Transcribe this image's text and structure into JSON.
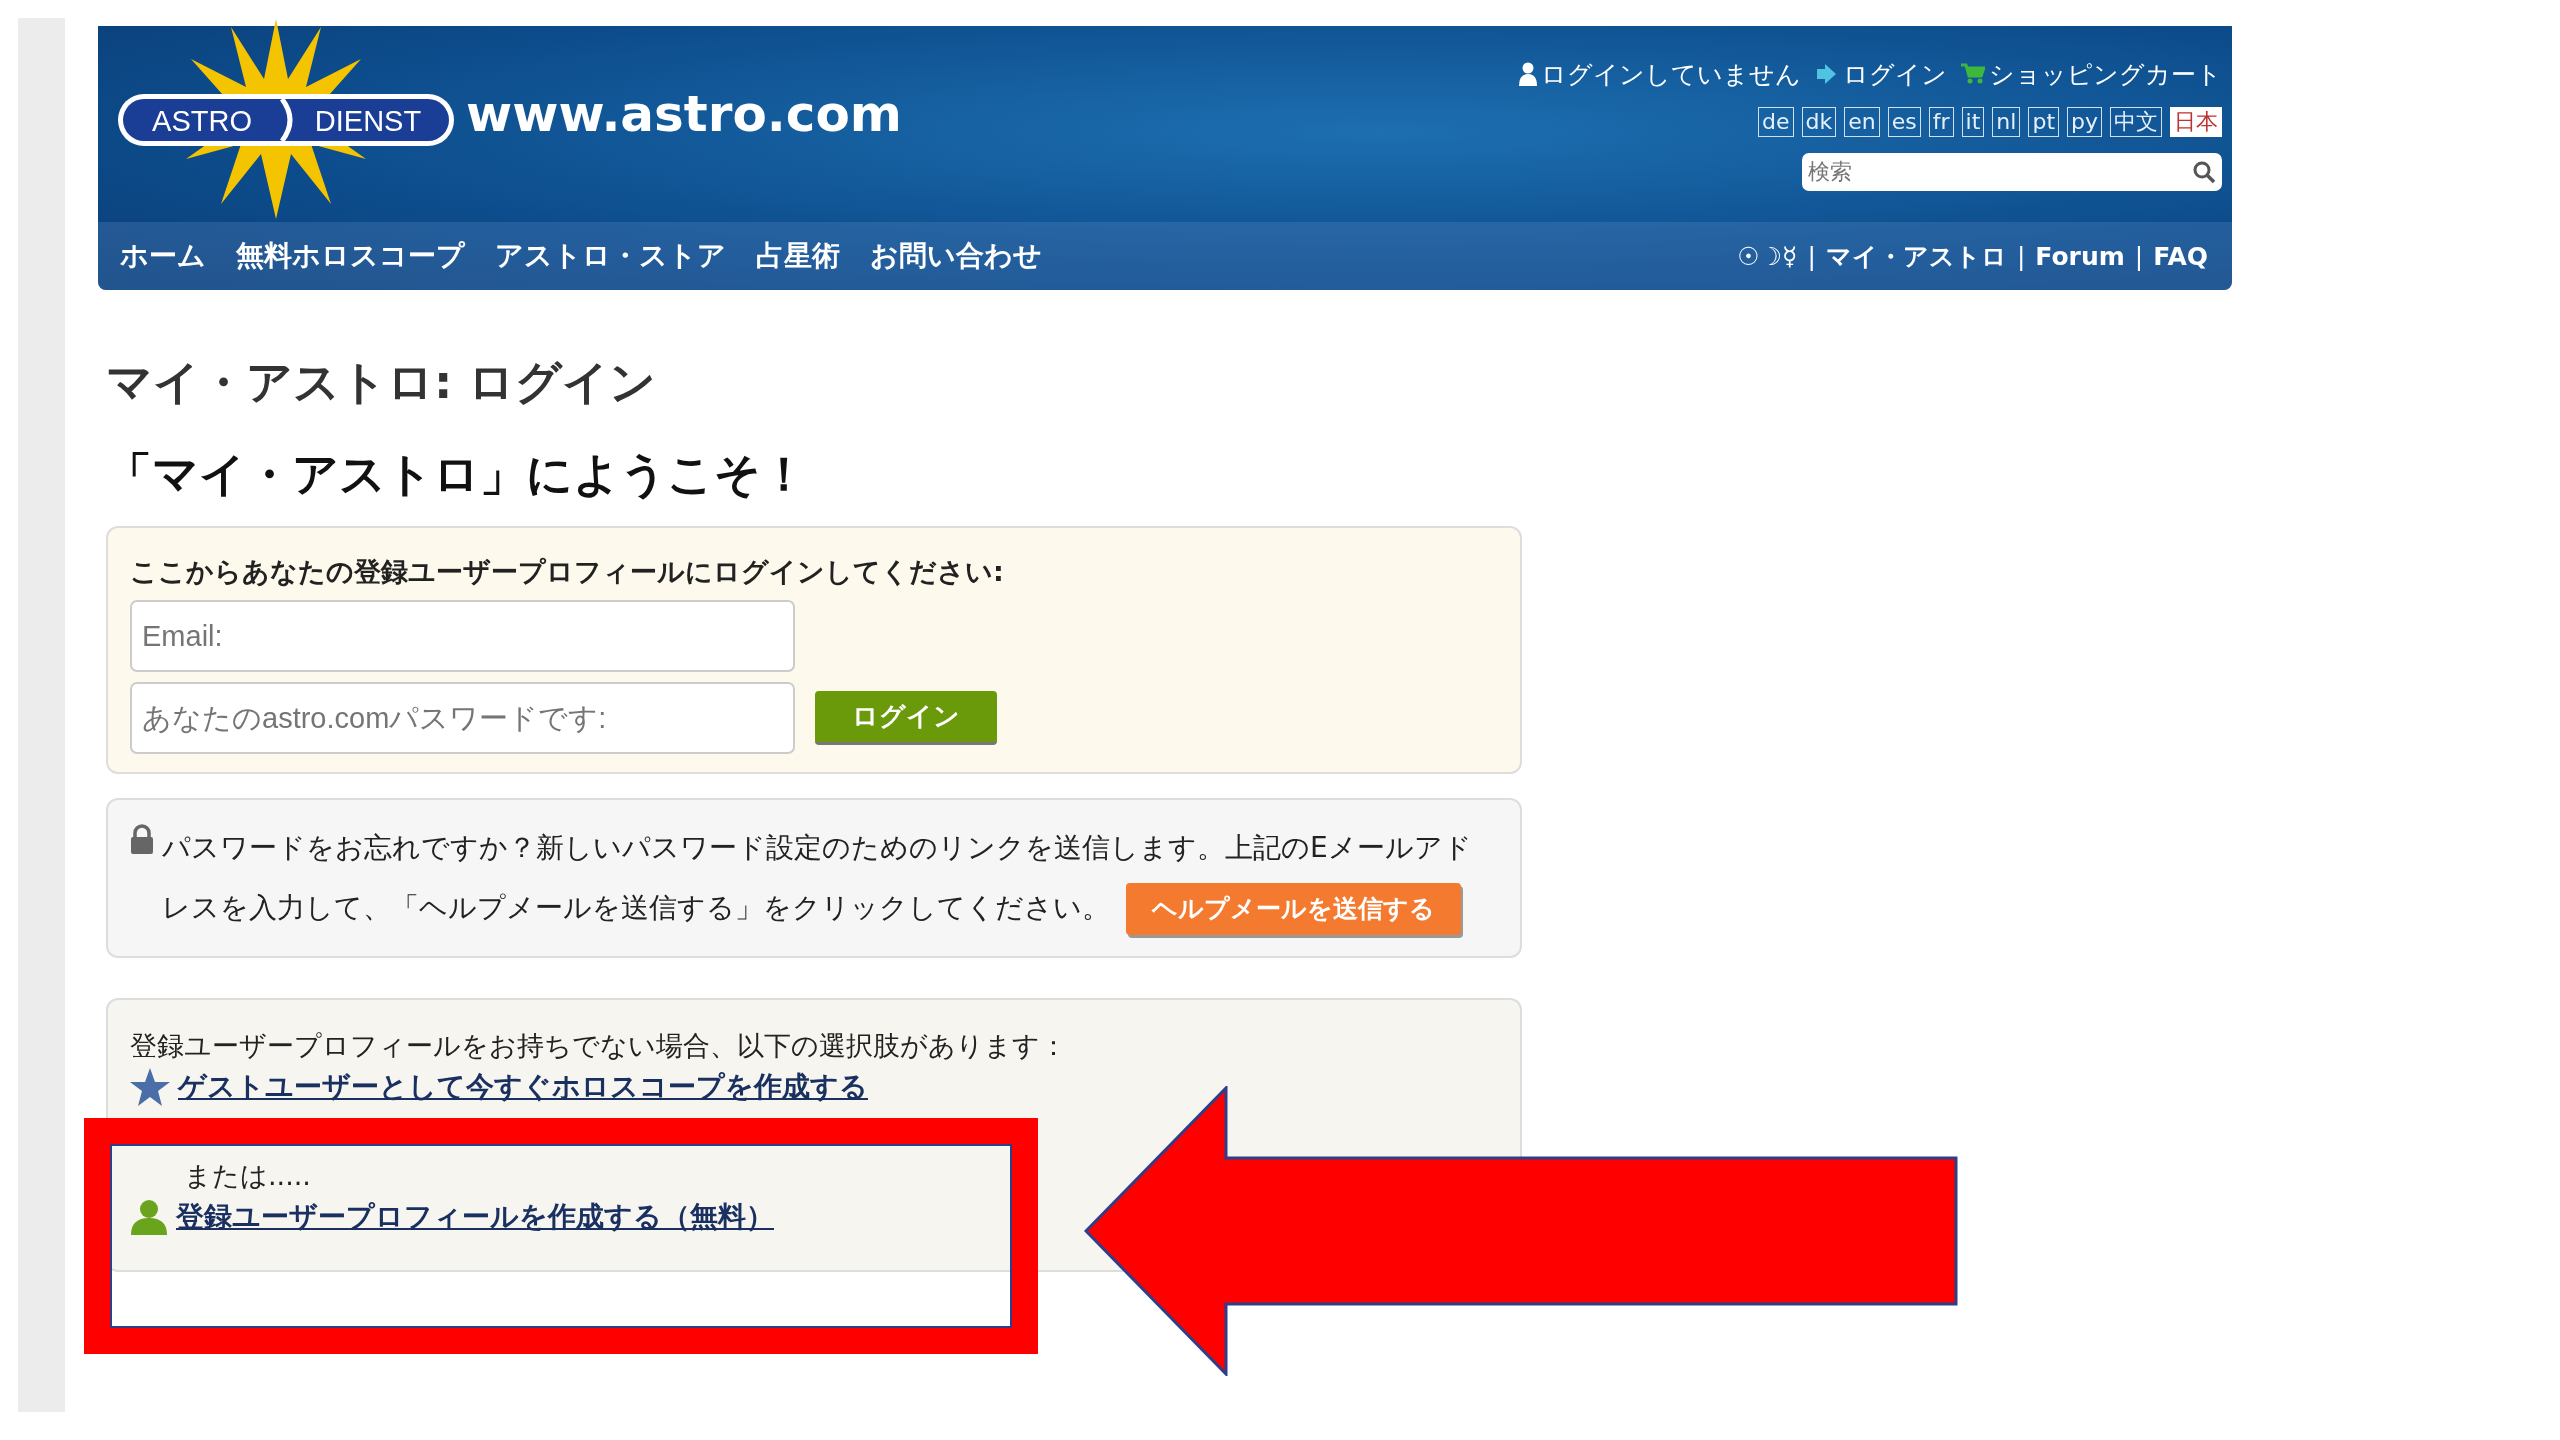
{
  "header": {
    "logo": {
      "left": "ASTRO",
      "right": "DIENST"
    },
    "site": "www.astro.com",
    "user_links": [
      {
        "kind": "status",
        "label": "ログインしていません"
      },
      {
        "kind": "login",
        "label": "ログイン"
      },
      {
        "kind": "cart",
        "label": "ショッピングカート"
      }
    ],
    "languages": [
      {
        "label": "de",
        "selected": false
      },
      {
        "label": "dk",
        "selected": false
      },
      {
        "label": "en",
        "selected": false
      },
      {
        "label": "es",
        "selected": false
      },
      {
        "label": "fr",
        "selected": false
      },
      {
        "label": "it",
        "selected": false
      },
      {
        "label": "nl",
        "selected": false
      },
      {
        "label": "pt",
        "selected": false
      },
      {
        "label": "ру",
        "selected": false
      },
      {
        "label": "中文",
        "selected": false
      },
      {
        "label": "日本",
        "selected": true
      }
    ],
    "search": {
      "placeholder": "検索"
    },
    "nav": [
      "ホーム",
      "無料ホロスコープ",
      "アストロ・ストア",
      "占星術",
      "お問い合わせ"
    ],
    "nav_right": [
      {
        "kind": "symbols",
        "label": "☉☽☿"
      },
      {
        "kind": "separator",
        "label": "|"
      },
      {
        "kind": "link",
        "label": "マイ・アストロ"
      },
      {
        "kind": "separator",
        "label": "|"
      },
      {
        "kind": "link",
        "label": "Forum"
      },
      {
        "kind": "separator",
        "label": "|"
      },
      {
        "kind": "link",
        "label": "FAQ"
      }
    ]
  },
  "title": "マイ・アストロ: ログイン",
  "welcome": "「マイ・アストロ」にようこそ！",
  "login": {
    "prompt": "ここからあなたの登録ユーザープロフィールにログインしてください:",
    "email": {
      "placeholder": "Email:"
    },
    "password": {
      "placeholder": "あなたのastro.comパスワードです:"
    },
    "button": "ログイン"
  },
  "forgot": {
    "text": "パスワードをお忘れですか？新しいパスワード設定のためのリンクを送信します。上記のEメールアドレスを入力して、「ヘルプメールを送信する」をクリックしてください。",
    "button": "ヘルプメールを送信する"
  },
  "register": {
    "intro": "登録ユーザープロフィールをお持ちでない場合、以下の選択肢があります：",
    "guest_link": "ゲストユーザーとして今すぐホロスコープを作成する",
    "or_text": "または.....",
    "register_link": "登録ユーザープロフィールを作成する（無料）"
  }
}
